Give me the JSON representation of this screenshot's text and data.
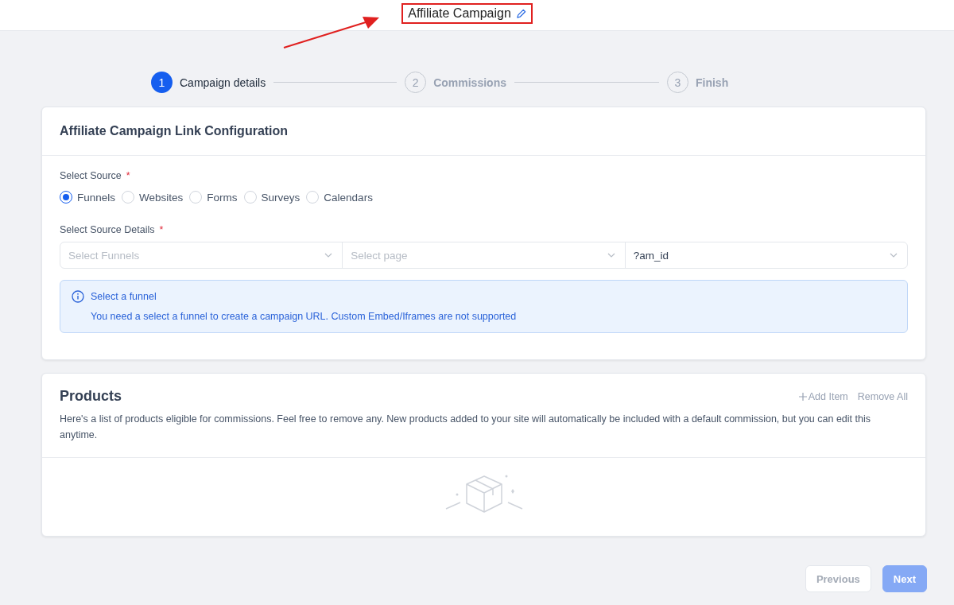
{
  "header": {
    "title": "Affiliate Campaign"
  },
  "steps": [
    {
      "number": "1",
      "label": "Campaign details",
      "selected": true
    },
    {
      "number": "2",
      "label": "Commissions",
      "selected": false
    },
    {
      "number": "3",
      "label": "Finish",
      "selected": false
    }
  ],
  "link_config": {
    "title": "Affiliate Campaign Link Configuration",
    "source_label": "Select Source",
    "required_mark": "*",
    "sources": [
      {
        "label": "Funnels",
        "selected": true
      },
      {
        "label": "Websites",
        "selected": false
      },
      {
        "label": "Forms",
        "selected": false
      },
      {
        "label": "Surveys",
        "selected": false
      },
      {
        "label": "Calendars",
        "selected": false
      }
    ],
    "details_label": "Select Source Details",
    "details_required_mark": "*",
    "selects": [
      {
        "placeholder": "Select Funnels"
      },
      {
        "placeholder": "Select page"
      },
      {
        "value": "?am_id"
      }
    ],
    "alert": {
      "title": "Select a funnel",
      "message": "You need a select a funnel to create a campaign URL. Custom Embed/Iframes are not supported"
    }
  },
  "products": {
    "title": "Products",
    "add_item": "Add Item",
    "remove_all": "Remove All",
    "description": "Here's a list of products eligible for commissions. Feel free to remove any. New products added to your site will automatically be included with a default commission, but you can edit this anytime."
  },
  "footer": {
    "buttons": [
      {
        "label": "Previous",
        "kind": "secondary",
        "disabled": true
      },
      {
        "label": "Next",
        "kind": "primary",
        "disabled": true
      }
    ]
  }
}
